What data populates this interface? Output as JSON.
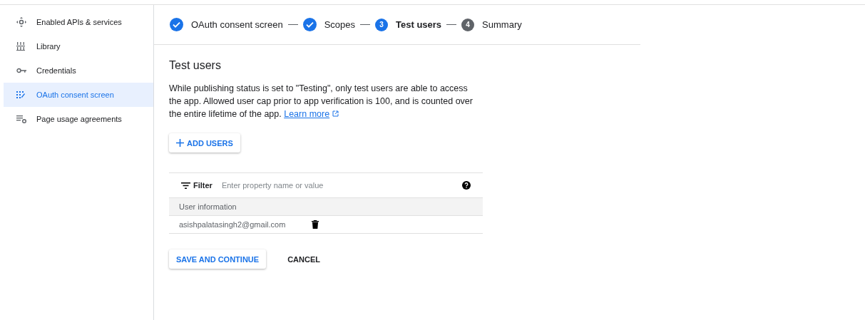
{
  "sidebar": {
    "items": [
      {
        "label": "Enabled APIs & services",
        "selected": false
      },
      {
        "label": "Library",
        "selected": false
      },
      {
        "label": "Credentials",
        "selected": false
      },
      {
        "label": "OAuth consent screen",
        "selected": true
      },
      {
        "label": "Page usage agreements",
        "selected": false
      }
    ]
  },
  "stepper": {
    "steps": [
      {
        "label": "OAuth consent screen",
        "kind": "done"
      },
      {
        "label": "Scopes",
        "kind": "done"
      },
      {
        "number": "3",
        "label": "Test users",
        "kind": "current"
      },
      {
        "number": "4",
        "label": "Summary",
        "kind": "upcoming"
      }
    ]
  },
  "section": {
    "title": "Test users",
    "description": "While publishing status is set to \"Testing\", only test users are able to access the app. Allowed user cap prior to app verification is 100, and is counted over the entire lifetime of the app.",
    "link": "Learn more"
  },
  "add_button": "ADD USERS",
  "table": {
    "filter_label": "Filter",
    "filter_placeholder": "Enter property name or value",
    "columns": [
      "User information"
    ],
    "rows": [
      {
        "email": "asishpalatasingh2@gmail.com"
      }
    ]
  },
  "buttons": {
    "primary": "SAVE AND CONTINUE",
    "secondary": "CANCEL"
  }
}
